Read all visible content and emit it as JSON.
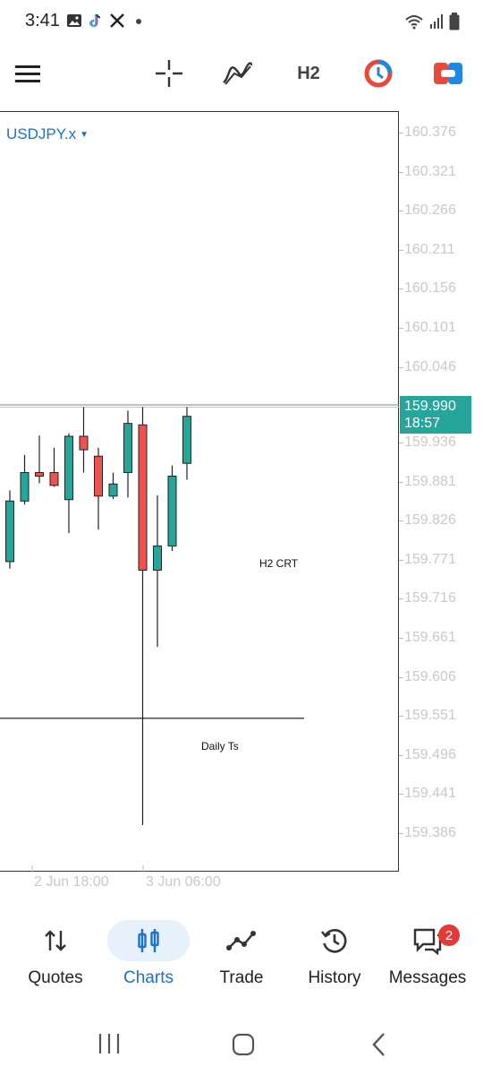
{
  "status_bar": {
    "time": "3:41",
    "left_icons": [
      "gallery-icon",
      "tiktok-icon",
      "x-icon",
      "dot-icon"
    ],
    "right_icons": [
      "wifi-icon",
      "signal-icon",
      "battery-icon"
    ]
  },
  "toolbar": {
    "timeframe": "H2"
  },
  "chart": {
    "symbol": "USDJPY.x",
    "price_labels": [
      "160.376",
      "160.321",
      "160.266",
      "160.211",
      "160.156",
      "160.101",
      "160.046",
      "159.936",
      "159.881",
      "159.826",
      "159.771",
      "159.716",
      "159.661",
      "159.606",
      "159.551",
      "159.496",
      "159.441",
      "159.386"
    ],
    "current_price": "159.990",
    "countdown": "18:57",
    "time_labels": [
      "2 Jun 18:00",
      "3 Jun 06:00"
    ],
    "annotations": {
      "h2": "H2 CRT",
      "daily": "Daily Ts"
    },
    "colors": {
      "bull": "#26a69a",
      "bear": "#ef5350",
      "symbol": "#1a73c9"
    }
  },
  "chart_data": {
    "type": "candlestick",
    "symbol": "USDJPY.x",
    "timeframe": "H2",
    "ylim": [
      159.36,
      160.39
    ],
    "candles": [
      {
        "o": 159.77,
        "h": 159.87,
        "l": 159.76,
        "c": 159.855
      },
      {
        "o": 159.855,
        "h": 159.92,
        "l": 159.85,
        "c": 159.895
      },
      {
        "o": 159.895,
        "h": 159.947,
        "l": 159.88,
        "c": 159.89
      },
      {
        "o": 159.895,
        "h": 159.93,
        "l": 159.875,
        "c": 159.877
      },
      {
        "o": 159.857,
        "h": 159.95,
        "l": 159.81,
        "c": 159.946
      },
      {
        "o": 159.946,
        "h": 159.987,
        "l": 159.895,
        "c": 159.927
      },
      {
        "o": 159.918,
        "h": 159.93,
        "l": 159.815,
        "c": 159.862
      },
      {
        "o": 159.862,
        "h": 159.895,
        "l": 159.858,
        "c": 159.879
      },
      {
        "o": 159.895,
        "h": 159.982,
        "l": 159.86,
        "c": 159.964
      },
      {
        "o": 159.962,
        "h": 159.987,
        "l": 159.4,
        "c": 159.758
      },
      {
        "o": 159.758,
        "h": 159.863,
        "l": 159.65,
        "c": 159.792
      },
      {
        "o": 159.792,
        "h": 159.905,
        "l": 159.785,
        "c": 159.89
      },
      {
        "o": 159.908,
        "h": 159.987,
        "l": 159.885,
        "c": 159.974
      }
    ],
    "horizontal_lines": [
      {
        "label": "",
        "price": 159.99
      },
      {
        "label": "Daily Ts",
        "price": 159.55
      }
    ]
  },
  "bottom_nav": {
    "items": [
      {
        "label": "Quotes",
        "icon": "quotes-icon",
        "active": false
      },
      {
        "label": "Charts",
        "icon": "charts-icon",
        "active": true
      },
      {
        "label": "Trade",
        "icon": "trade-icon",
        "active": false
      },
      {
        "label": "History",
        "icon": "history-icon",
        "active": false
      },
      {
        "label": "Messages",
        "icon": "messages-icon",
        "active": false,
        "badge": "2"
      }
    ]
  }
}
